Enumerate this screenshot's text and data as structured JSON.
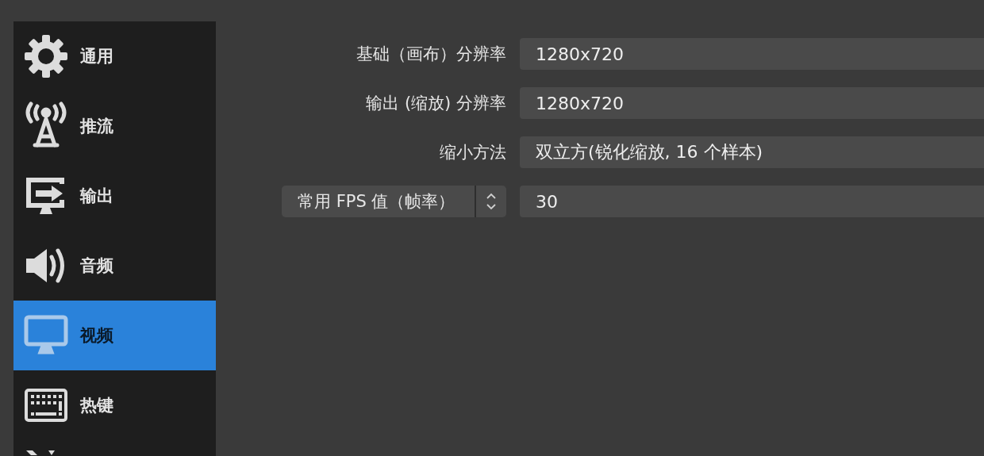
{
  "sidebar": {
    "items": [
      {
        "label": "通用",
        "selected": false
      },
      {
        "label": "推流",
        "selected": false
      },
      {
        "label": "输出",
        "selected": false
      },
      {
        "label": "音频",
        "selected": false
      },
      {
        "label": "视频",
        "selected": true
      },
      {
        "label": "热键",
        "selected": false
      }
    ]
  },
  "settings": [
    {
      "kind": "label",
      "label": "基础（画布）分辨率",
      "value": "1280x720"
    },
    {
      "kind": "label",
      "label": "输出 (缩放) 分辨率",
      "value": "1280x720"
    },
    {
      "kind": "label",
      "label": "缩小方法",
      "value": "双立方(锐化缩放, 16 个样本)"
    },
    {
      "kind": "dropdown",
      "label": "常用 FPS 值（帧率）",
      "value": "30"
    }
  ]
}
